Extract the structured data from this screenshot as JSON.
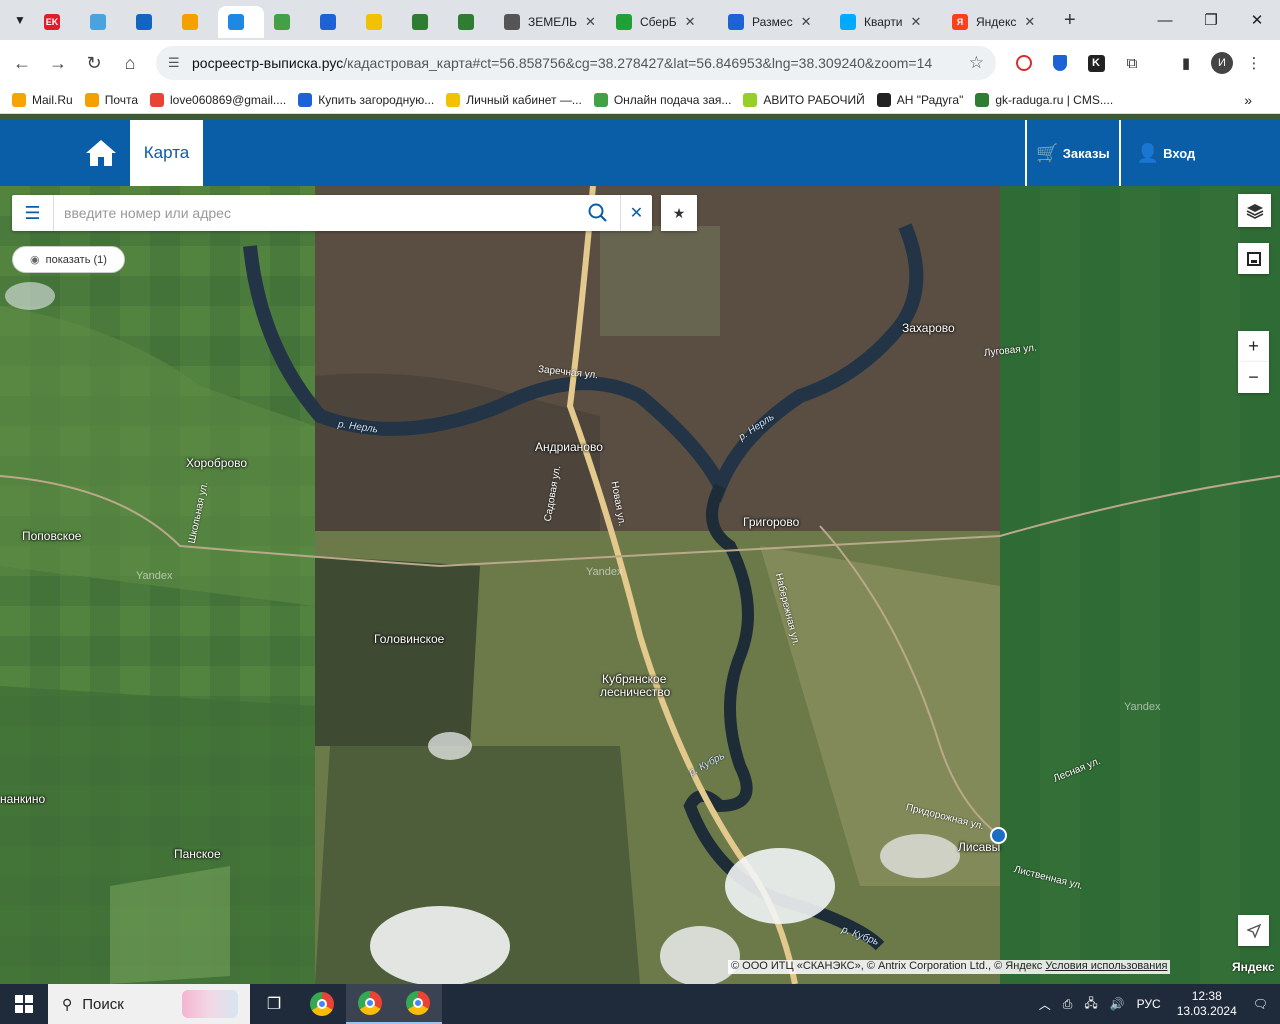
{
  "browser": {
    "tabs": [
      {
        "label": "",
        "favicon_text": "EK",
        "favicon_color": "#e11d2a"
      },
      {
        "label": "",
        "favicon_text": "",
        "favicon_color": "#4aa3df"
      },
      {
        "label": "",
        "favicon_text": "",
        "favicon_color": "#1565c0"
      },
      {
        "label": "",
        "favicon_text": "",
        "favicon_color": "#f4a100"
      },
      {
        "label": "",
        "favicon_text": "",
        "favicon_color": "#1e88e5",
        "active": true
      },
      {
        "label": "",
        "favicon_text": "",
        "favicon_color": "#43a047"
      },
      {
        "label": "",
        "favicon_text": "",
        "favicon_color": "#1e63d6"
      },
      {
        "label": "",
        "favicon_text": "",
        "favicon_color": "#f2c200"
      },
      {
        "label": "",
        "favicon_text": "",
        "favicon_color": "#2e7d32"
      },
      {
        "label": "",
        "favicon_text": "",
        "favicon_color": "#2e7d32"
      },
      {
        "label": "ЗЕМЕЛЬ",
        "favicon_text": "",
        "favicon_color": "#555555"
      },
      {
        "label": "СберБ",
        "favicon_text": "",
        "favicon_color": "#21a038"
      },
      {
        "label": "Размес",
        "favicon_text": "",
        "favicon_color": "#1e63d6"
      },
      {
        "label": "Кварти",
        "favicon_text": "",
        "favicon_color": "#00aaff"
      },
      {
        "label": "Яндекс",
        "favicon_text": "Я",
        "favicon_color": "#fc3f1d"
      }
    ],
    "url_host": "росреестр-выписка.рус",
    "url_path": "/кадастровая_карта#ct=56.858756&cg=38.278427&lat=56.846953&lng=38.309240&zoom=14",
    "bookmarks": [
      {
        "label": "Mail.Ru",
        "color": "#f6a400"
      },
      {
        "label": "Почта",
        "color": "#f4a100"
      },
      {
        "label": "love060869@gmail....",
        "color": "#ea4335"
      },
      {
        "label": "Купить загородную...",
        "color": "#1e63d6"
      },
      {
        "label": "Личный кабинет —...",
        "color": "#f2c200"
      },
      {
        "label": "Онлайн подача зая...",
        "color": "#43a047"
      },
      {
        "label": "АВИТО РАБОЧИЙ",
        "color": "#97cf26"
      },
      {
        "label": "АН \"Радуга\"",
        "color": "#222222"
      },
      {
        "label": "gk-raduga.ru | CMS....",
        "color": "#2e7d32"
      }
    ],
    "profile_letter": "И"
  },
  "site": {
    "map_tab": "Карта",
    "orders_label": "Заказы",
    "login_label": "Вход"
  },
  "search": {
    "placeholder": "введите номер или адрес",
    "show_label": "показать (1)"
  },
  "map": {
    "places": [
      {
        "name": "Захарово"
      },
      {
        "name": "Андрианово"
      },
      {
        "name": "Хороброво"
      },
      {
        "name": "Поповское"
      },
      {
        "name": "Григорово"
      },
      {
        "name": "Головинское"
      },
      {
        "name": "Кубрянское"
      },
      {
        "name": "лесничество"
      },
      {
        "name": "нанкино"
      },
      {
        "name": "Панское"
      },
      {
        "name": "Лисавы"
      }
    ],
    "streets": [
      "Заречная ул.",
      "Луговая ул.",
      "Садовая ул.",
      "Новая ул.",
      "Школьная ул.",
      "Набережная ул.",
      "Придорожная ул.",
      "Лесная ул.",
      "Лиственная ул."
    ],
    "rivers": [
      "р. Нерль",
      "р. Нерль",
      "р. Кубрь",
      "р. Кубрь"
    ],
    "watermark": "Yandex",
    "copyright_text": "© ООО ИТЦ «СКАНЭКС», © Antrix Corporation Ltd., © Яндекс ",
    "terms_link": "Условия использования",
    "logo": "Яндекс"
  },
  "taskbar": {
    "search_label": "Поиск",
    "lang": "РУС",
    "time": "12:38",
    "date": "13.03.2024"
  }
}
